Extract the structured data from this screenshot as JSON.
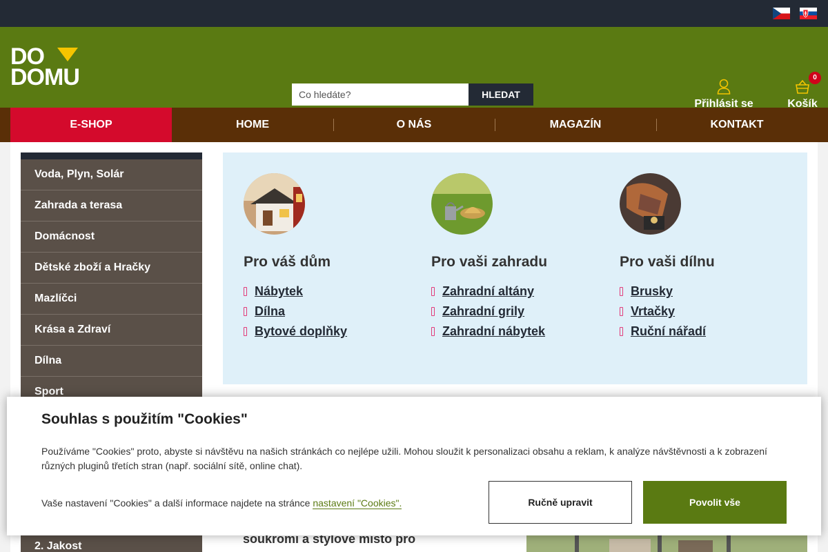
{
  "topbar": {
    "languages": [
      {
        "icon": "czech-flag-icon"
      },
      {
        "icon": "slovak-flag-icon"
      }
    ]
  },
  "header": {
    "logo_line1": "DO",
    "logo_line2": "DOMU",
    "search_placeholder": "Co hledáte?",
    "search_button": "HLEDAT",
    "login_label": "Přihlásit se",
    "cart_label": "Košík",
    "cart_count": "0"
  },
  "nav": {
    "items": [
      "E-SHOP",
      "HOME",
      "O NÁS",
      "MAGAZÍN",
      "KONTAKT"
    ]
  },
  "sidebar": {
    "categories": [
      "Voda, Plyn, Solár",
      "Zahrada a terasa",
      "Domácnost",
      "Dětské zboží a Hračky",
      "Mazlíčci",
      "Krása a Zdraví",
      "Dílna",
      "Sport"
    ],
    "bottom_item": "2. Jakost"
  },
  "panel": {
    "columns": [
      {
        "title": "Pro váš dům",
        "image_icon": "house-photo",
        "links": [
          "Nábytek",
          "Dílna",
          "Bytové doplňky"
        ]
      },
      {
        "title": "Pro vaši zahradu",
        "image_icon": "garden-photo",
        "links": [
          "Zahradní altány",
          "Zahradní grily",
          "Zahradní nábytek"
        ]
      },
      {
        "title": "Pro vaši dílnu",
        "image_icon": "workshop-photo",
        "links": [
          "Brusky",
          "Vrtačky",
          "Ruční nářadí"
        ]
      }
    ]
  },
  "below": {
    "text": "soukromí a stylové místo pro"
  },
  "cookie": {
    "title": "Souhlas s použitím \"Cookies\"",
    "text": "Používáme \"Cookies\" proto, abyste si návštěvu na našich stránkách co nejlépe užili. Mohou sloužit k personalizaci obsahu a reklam, k analýze návštěvnosti a k zobrazení různých pluginů třetích stran (např. sociální sítě, online chat).",
    "settings_text": "Vaše nastavení \"Cookies\" a další informace najdete na stránce ",
    "settings_link": "nastavení \"Cookies\".",
    "manual_button": "Ručně upravit",
    "allow_button": "Povolit vše"
  },
  "colors": {
    "header_green": "#5a7a12",
    "nav_brown": "#5a2f07",
    "eshop_red": "#d40a2c",
    "topbar_dark": "#232a35",
    "panel_blue": "#dff0f9"
  }
}
